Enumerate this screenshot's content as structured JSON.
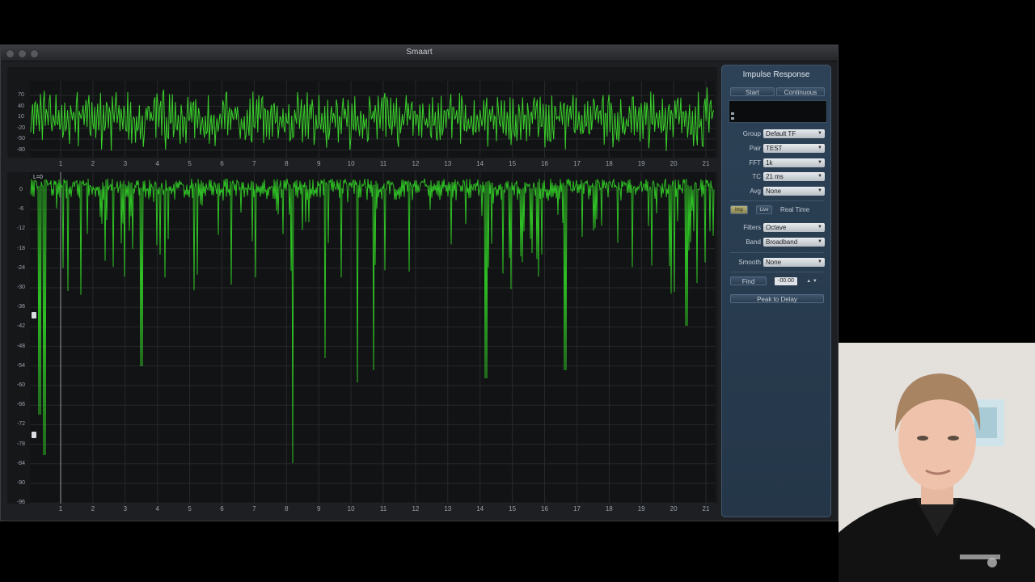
{
  "window": {
    "title": "Smaart"
  },
  "top_plot": {
    "y_ticks": [
      "70",
      "40",
      "10",
      "-20",
      "-50",
      "-80"
    ],
    "x_ticks": [
      "1",
      "2",
      "3",
      "4",
      "5",
      "6",
      "7",
      "8",
      "9",
      "10",
      "11",
      "12",
      "13",
      "14",
      "15",
      "16",
      "17",
      "18",
      "19",
      "20",
      "21"
    ]
  },
  "bottom_plot": {
    "y_ticks": [
      "0",
      "-6",
      "-12",
      "-18",
      "-24",
      "-30",
      "-36",
      "-42",
      "-48",
      "-54",
      "-60",
      "-66",
      "-72",
      "-78",
      "-84",
      "-90",
      "-96"
    ],
    "x_ticks": [
      "1",
      "2",
      "3",
      "4",
      "5",
      "6",
      "7",
      "8",
      "9",
      "10",
      "11",
      "12",
      "13",
      "14",
      "15",
      "16",
      "17",
      "18",
      "19",
      "20",
      "21"
    ],
    "marker_label": "L=0"
  },
  "panel": {
    "title": "Impulse Response",
    "start_label": "Start",
    "continuous_label": "Continuous",
    "group_label": "Group",
    "group_value": "Default TF",
    "pair_label": "Pair",
    "pair_value": "TEST",
    "fft_label": "FFT",
    "fft_value": "1k",
    "tc_label": "TC",
    "tc_value": "21 ms",
    "avg_label": "Avg",
    "avg_value": "None",
    "mode_a": "Imp",
    "mode_b": "Live",
    "real_time_label": "Real Time",
    "filters_label": "Filters",
    "filters_value": "Octave",
    "band_label": "Band",
    "band_value": "Broadband",
    "smooth_label": "Smooth",
    "smooth_value": "None",
    "find_label": "Find",
    "find_value": "-00.00",
    "peak_label": "Peak to Delay"
  },
  "colors": {
    "trace": "#3ad12c",
    "panel": "#2a3e52",
    "plot_bg": "#161719"
  }
}
